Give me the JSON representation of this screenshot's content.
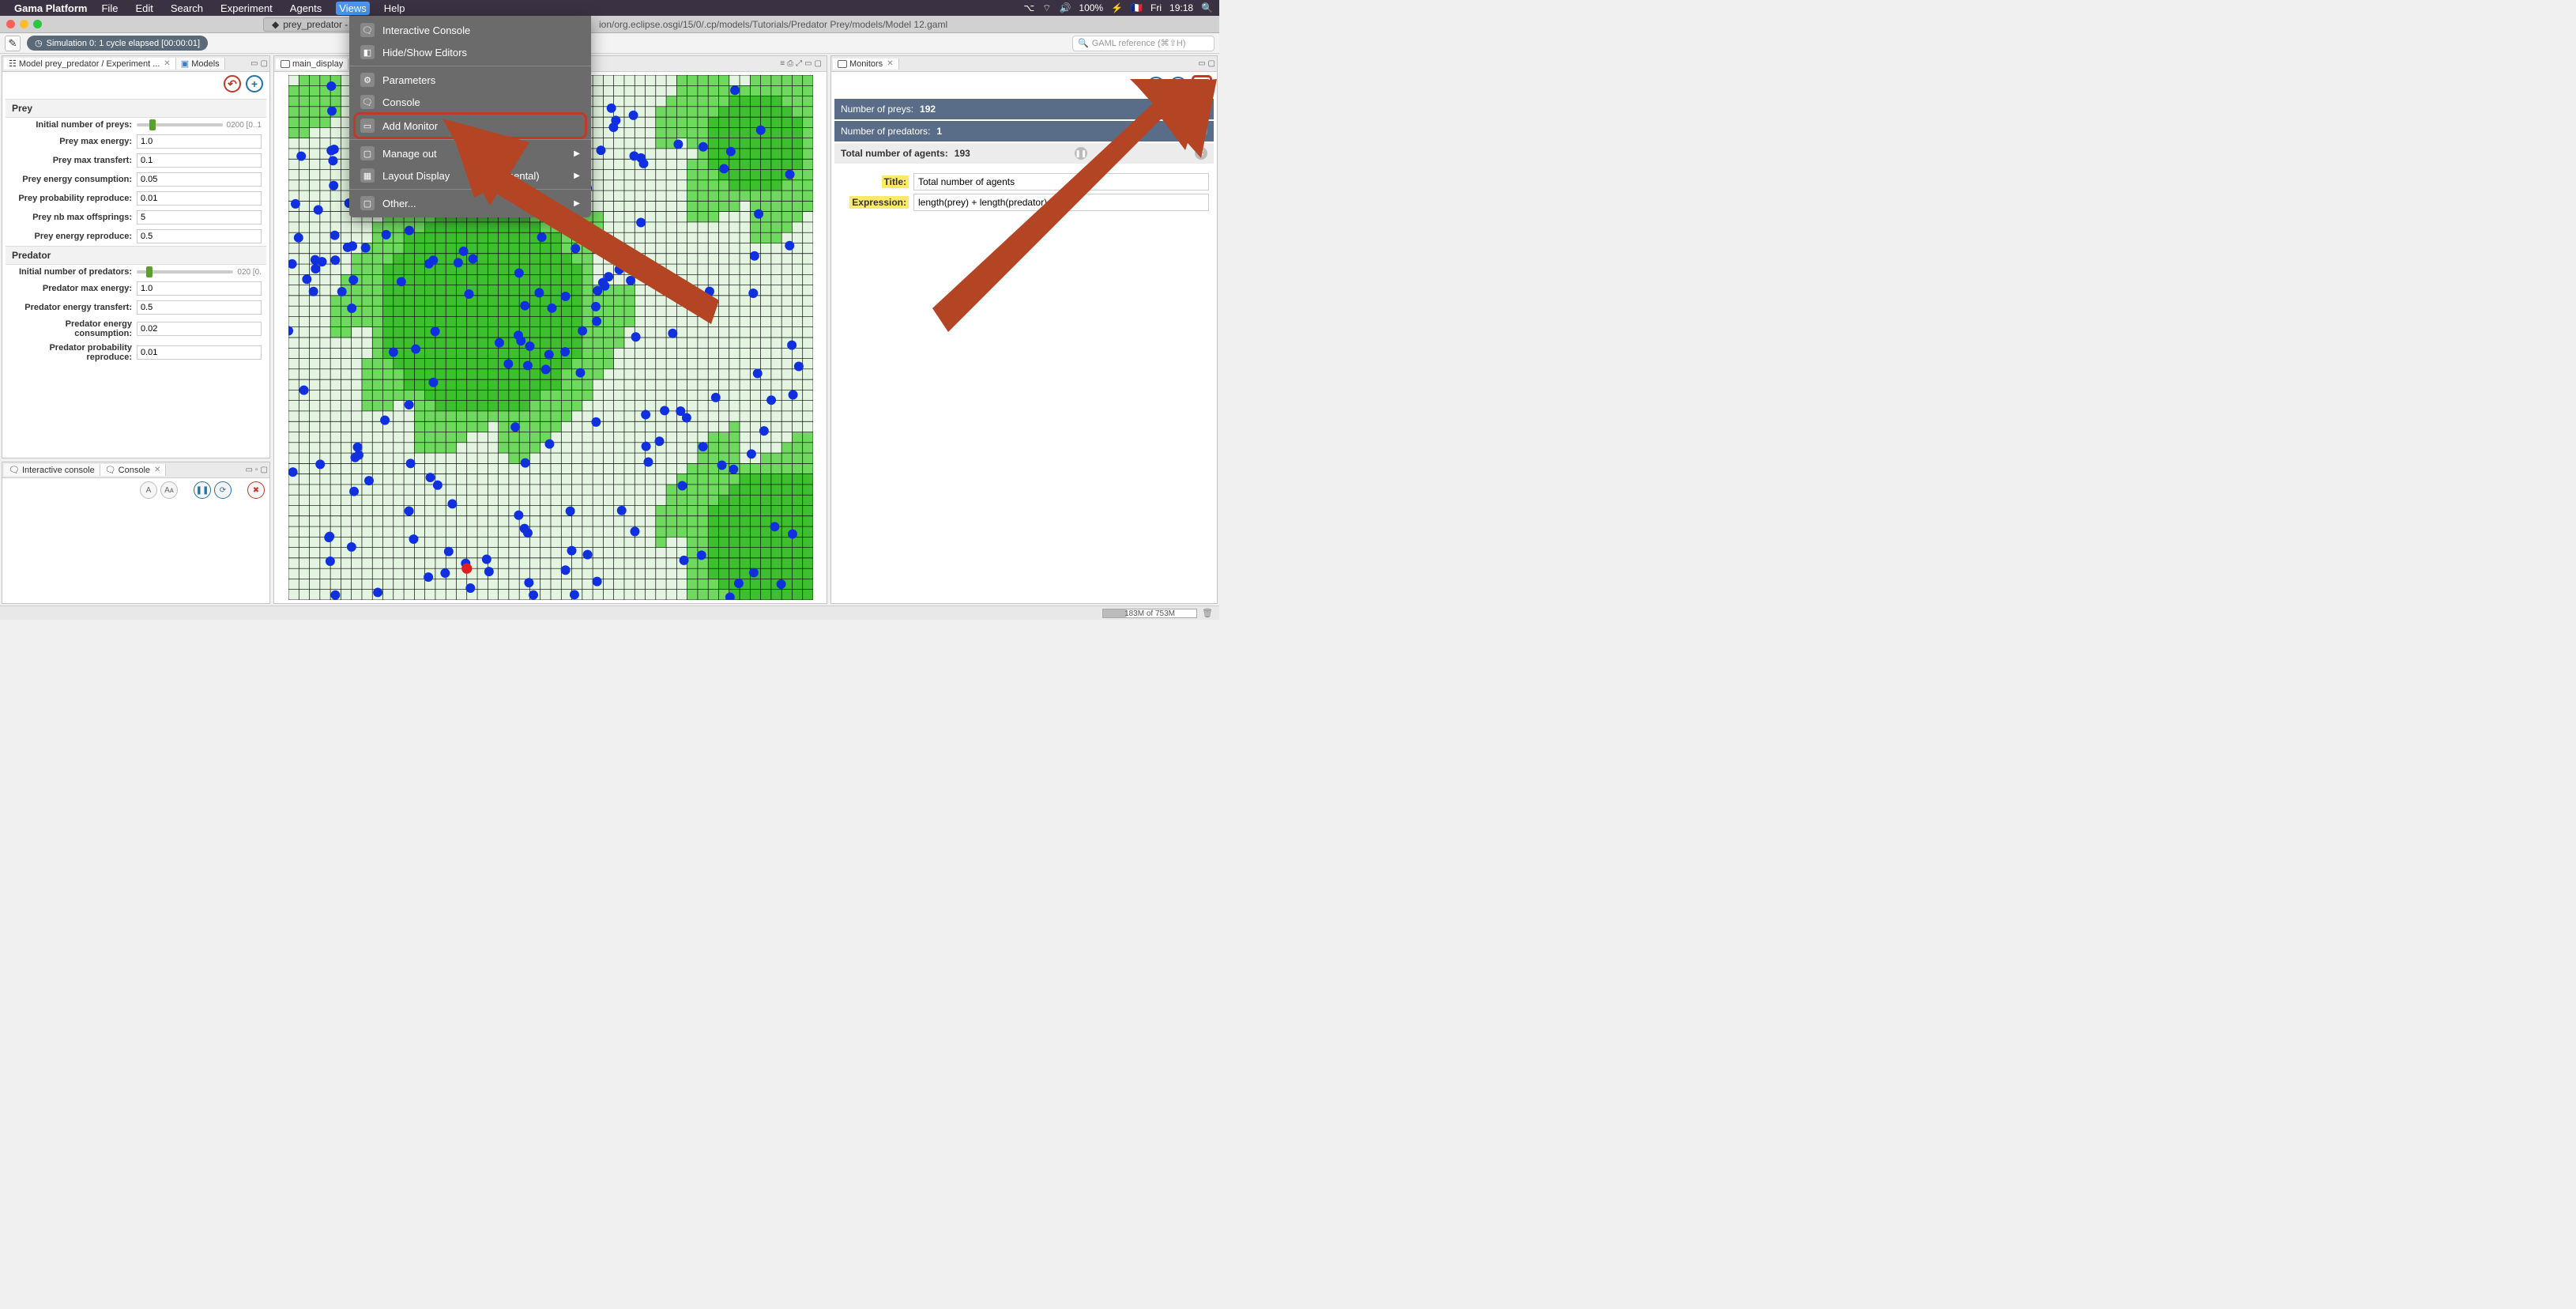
{
  "menubar": {
    "app": "Gama Platform",
    "items": [
      "File",
      "Edit",
      "Search",
      "Experiment",
      "Agents",
      "Views",
      "Help"
    ],
    "active": "Views",
    "tray": {
      "battery": "100%",
      "flag": "🇫🇷",
      "day": "Fri",
      "time": "19:18"
    }
  },
  "tab": {
    "title": "prey_predator - /Ap"
  },
  "path": "ion/org.eclipse.osgi/15/0/.cp/models/Tutorials/Predator Prey/models/Model 12.gaml",
  "sim_pill": "Simulation 0: 1 cycle elapsed [00:00:01]",
  "search_ph": "GAML reference (⌘⇧H)",
  "left": {
    "tab_model": "Model prey_predator / Experiment ...",
    "btn_models": "Models",
    "groups": {
      "prey": {
        "title": "Prey",
        "p1": {
          "label": "Initial number of preys:",
          "hint": "0200 [0..1"
        },
        "p2": {
          "label": "Prey max energy:",
          "val": "1.0"
        },
        "p3": {
          "label": "Prey max transfert:",
          "val": "0.1"
        },
        "p4": {
          "label": "Prey energy consumption:",
          "val": "0.05"
        },
        "p5": {
          "label": "Prey probability reproduce:",
          "val": "0.01"
        },
        "p6": {
          "label": "Prey nb max offsprings:",
          "val": "5"
        },
        "p7": {
          "label": "Prey energy reproduce:",
          "val": "0.5"
        }
      },
      "pred": {
        "title": "Predator",
        "p1": {
          "label": "Initial number of predators:",
          "hint": "020 [0."
        },
        "p2": {
          "label": "Predator max energy:",
          "val": "1.0"
        },
        "p3": {
          "label": "Predator energy transfert:",
          "val": "0.5"
        },
        "p4": {
          "label": "Predator energy consumption:",
          "val": "0.02"
        },
        "p5": {
          "label": "Predator probability reproduce:",
          "val": "0.01"
        }
      }
    },
    "console_tabs": {
      "a": "Interactive console",
      "b": "Console"
    }
  },
  "center": {
    "tab": "main_display"
  },
  "right": {
    "tab": "Monitors",
    "m1": {
      "label": "Number of preys:",
      "val": "192"
    },
    "m2": {
      "label": "Number of predators:",
      "val": "1"
    },
    "m3": {
      "label": "Total number of agents:",
      "val": "193"
    },
    "form": {
      "title_lbl": "Title:",
      "title_val": "Total number of agents",
      "expr_lbl": "Expression:",
      "expr_val": "length(prey) + length(predator)"
    }
  },
  "dropdown": {
    "i1": "Interactive Console",
    "i2": "Hide/Show Editors",
    "i3": "Parameters",
    "i4": "Console",
    "i5": "Add Monitor",
    "i6": "Manage out",
    "i7": "Layout Display",
    "i7b": "mental)",
    "i8": "Other..."
  },
  "status": {
    "mem": "183M of 753M"
  }
}
